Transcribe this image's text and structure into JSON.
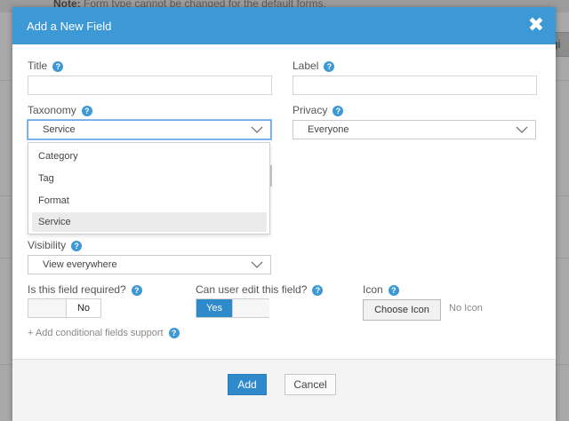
{
  "background": {
    "note_bold": "Note:",
    "note_text": " Form type cannot be changed for the default forms.",
    "right_stub": "ogi"
  },
  "modal": {
    "title": "Add a New Field",
    "close_glyph": "✖",
    "colors": {
      "header": "#3d98d6",
      "primary": "#2e8acb",
      "help": "#3d98d6"
    }
  },
  "fields": {
    "title": {
      "label": "Title",
      "value": ""
    },
    "label": {
      "label": "Label",
      "value": ""
    },
    "taxonomy": {
      "label": "Taxonomy",
      "selected": "Service",
      "options": [
        "Category",
        "Tag",
        "Format",
        "Service"
      ],
      "highlighted_option": "Service"
    },
    "privacy": {
      "label": "Privacy",
      "selected": "Everyone"
    },
    "visibility": {
      "label": "Visibility",
      "selected": "View everywhere"
    },
    "required": {
      "label": "Is this field required?",
      "state": "No"
    },
    "editable": {
      "label": "Can user edit this field?",
      "state": "Yes"
    },
    "icon": {
      "label": "Icon",
      "button": "Choose Icon",
      "status": "No Icon"
    },
    "conditional": {
      "plus": "+",
      "label": " Add conditional fields support"
    }
  },
  "help_glyph": "?",
  "footer": {
    "add_label": "Add",
    "cancel_label": "Cancel"
  }
}
